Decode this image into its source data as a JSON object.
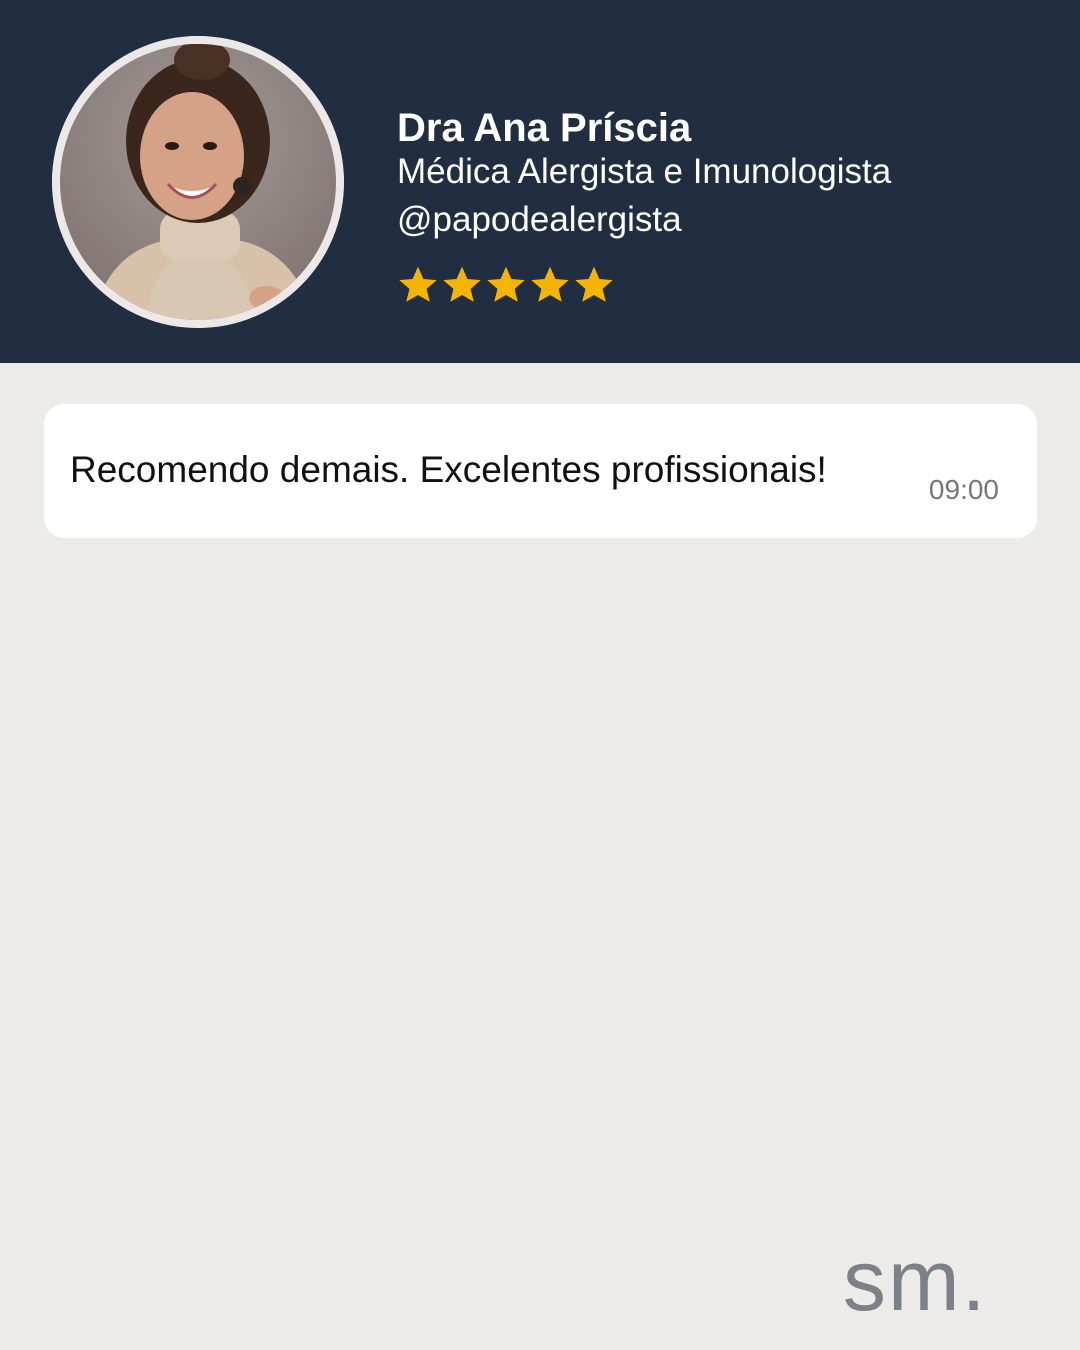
{
  "profile": {
    "name": "Dra Ana Príscia",
    "title": "Médica Alergista e Imunologista",
    "handle": "@papodealergista",
    "rating": 5,
    "avatar_icon": "profile-photo"
  },
  "review": {
    "text": "Recomendo demais. Excelentes profissionais!",
    "time": "09:00"
  },
  "brand": {
    "logo": "sm."
  },
  "colors": {
    "header_bg": "#212d41",
    "page_bg": "#edebea",
    "star": "#f5b400",
    "logo": "#7c8189"
  }
}
